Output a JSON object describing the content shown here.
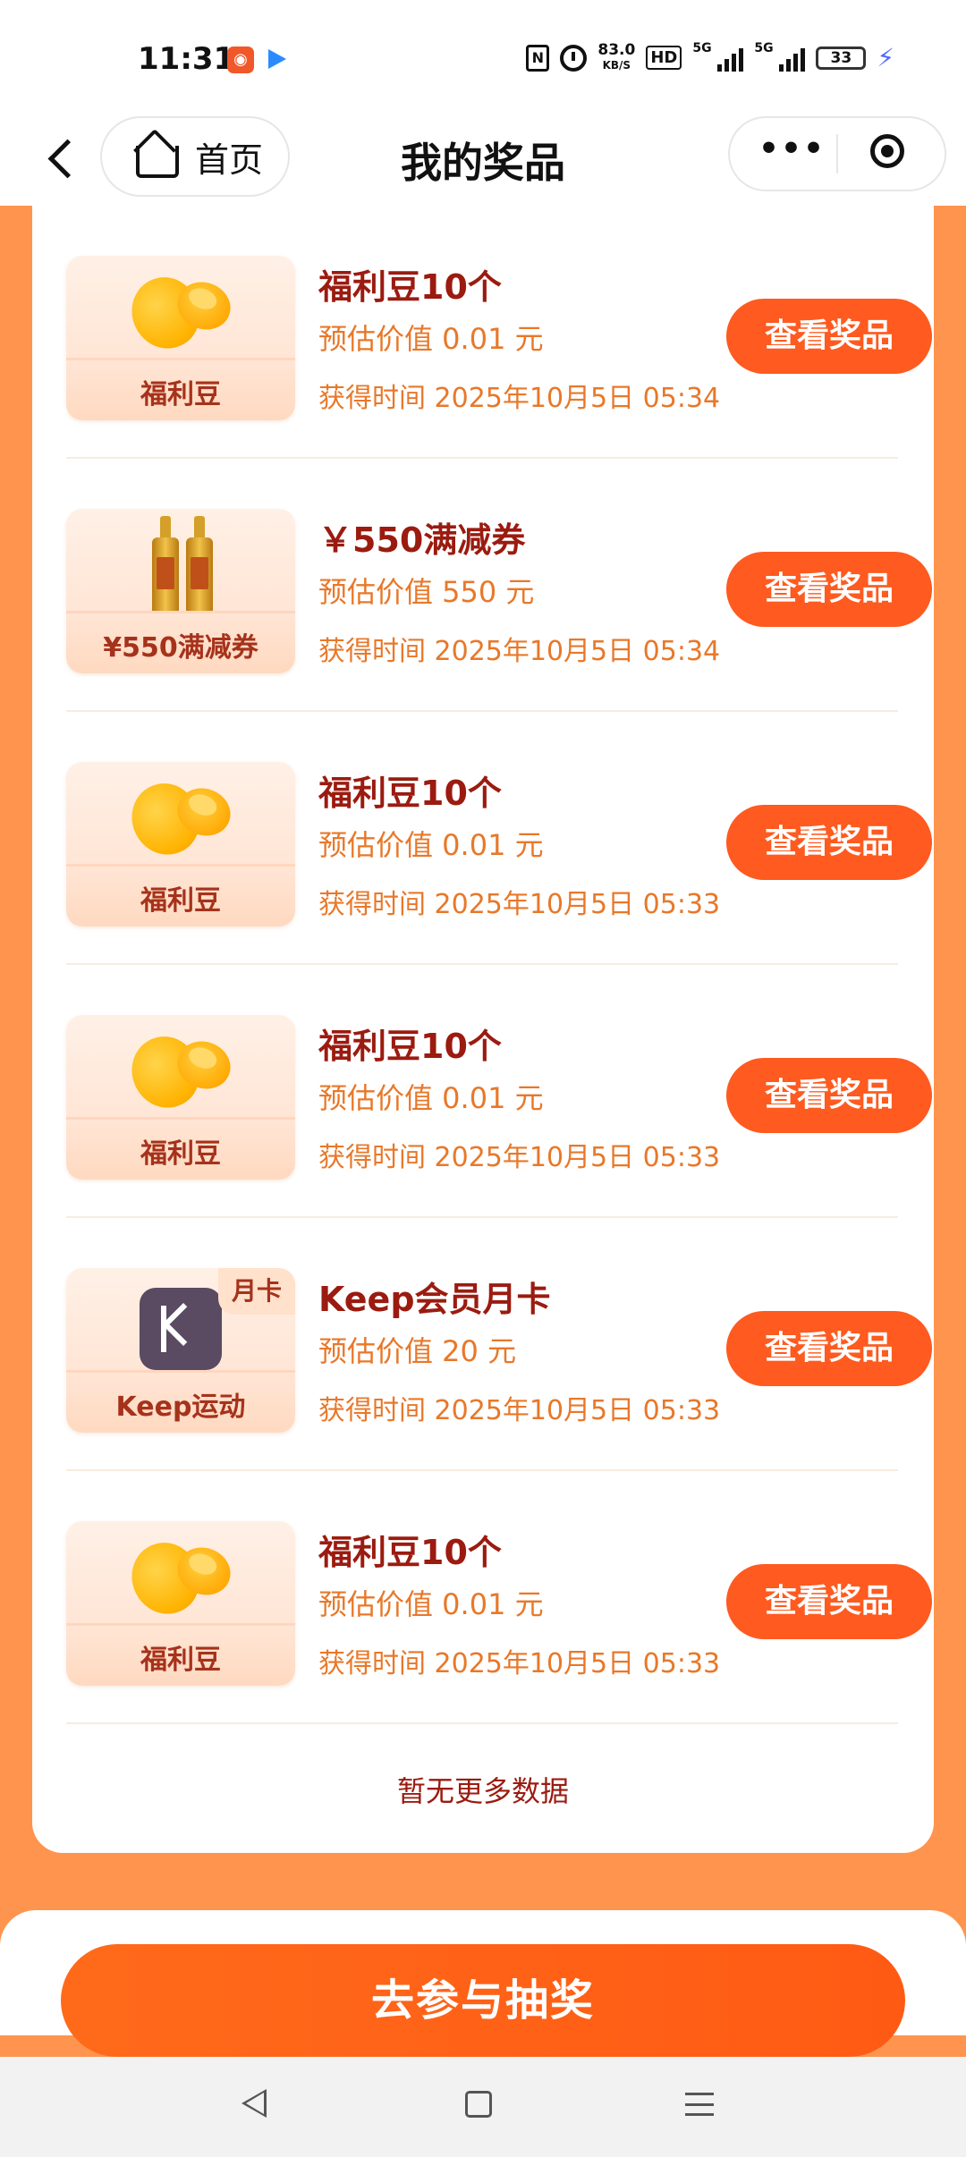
{
  "status_bar": {
    "time": "11:31",
    "nfc": "N",
    "net_speed": "83.0",
    "net_speed_unit": "KB/S",
    "hd": "HD",
    "signal1": "5G",
    "signal2": "5G",
    "battery": "33"
  },
  "title_bar": {
    "home_label": "首页",
    "title": "我的奖品"
  },
  "prizes": [
    {
      "thumb": "bean",
      "thumb_label": "福利豆",
      "name": "福利豆10个",
      "value": "预估价值 0.01 元",
      "time": "获得时间 2025年10月5日 05:34",
      "button": "查看奖品"
    },
    {
      "thumb": "bottle",
      "thumb_label": "¥550满减券",
      "name": "￥550满减券",
      "value": "预估价值 550 元",
      "time": "获得时间 2025年10月5日 05:34",
      "button": "查看奖品"
    },
    {
      "thumb": "bean",
      "thumb_label": "福利豆",
      "name": "福利豆10个",
      "value": "预估价值 0.01 元",
      "time": "获得时间 2025年10月5日 05:33",
      "button": "查看奖品"
    },
    {
      "thumb": "bean",
      "thumb_label": "福利豆",
      "name": "福利豆10个",
      "value": "预估价值 0.01 元",
      "time": "获得时间 2025年10月5日 05:33",
      "button": "查看奖品"
    },
    {
      "thumb": "keep",
      "thumb_label": "Keep运动",
      "thumb_tag": "月卡",
      "name": "Keep会员月卡",
      "value": "预估价值 20 元",
      "time": "获得时间 2025年10月5日 05:33",
      "button": "查看奖品"
    },
    {
      "thumb": "bean",
      "thumb_label": "福利豆",
      "name": "福利豆10个",
      "value": "预估价值 0.01 元",
      "time": "获得时间 2025年10月5日 05:33",
      "button": "查看奖品"
    }
  ],
  "list_end_text": "暂无更多数据",
  "primary_button": "去参与抽奖",
  "colors": {
    "accent": "#ff5a1f",
    "background": "#ff944e",
    "prize_name": "#9b1b10",
    "prize_meta": "#e8782a"
  }
}
